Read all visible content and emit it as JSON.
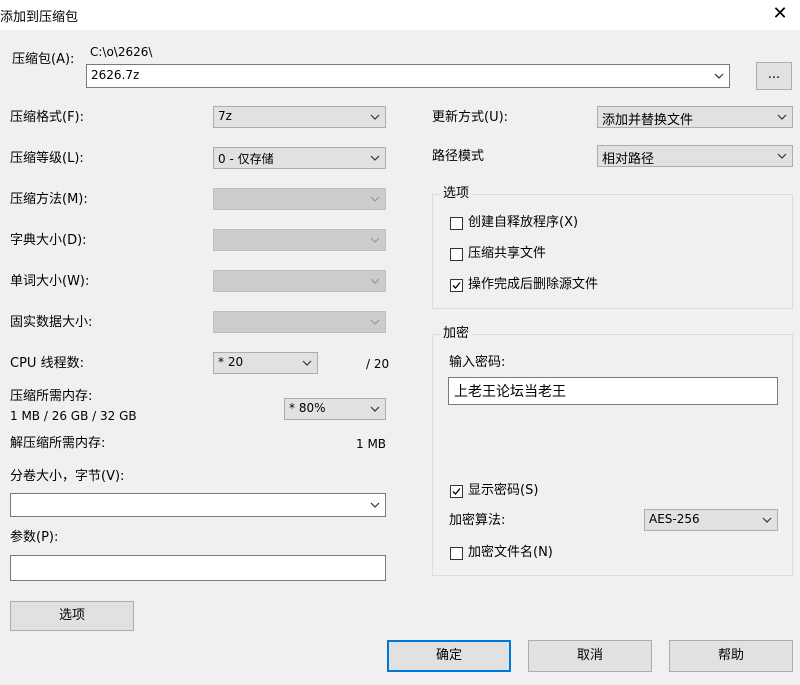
{
  "window": {
    "title": "添加到压缩包",
    "close_icon": "close-icon"
  },
  "archive": {
    "label": "压缩包(A):",
    "path": "C:\\o\\2626\\",
    "value": "2626.7z",
    "browse_label": "..."
  },
  "left": {
    "format": {
      "label": "压缩格式(F):",
      "value": "7z"
    },
    "level": {
      "label": "压缩等级(L):",
      "value": "0 - 仅存储"
    },
    "method": {
      "label": "压缩方法(M):",
      "value": ""
    },
    "dict": {
      "label": "字典大小(D):",
      "value": ""
    },
    "word": {
      "label": "单词大小(W):",
      "value": ""
    },
    "solid": {
      "label": "固实数据大小:",
      "value": ""
    },
    "cpu": {
      "label": "CPU 线程数:",
      "value": "* 20",
      "max": "/ 20"
    },
    "mem_compress": {
      "label": "压缩所需内存:",
      "detail": "1 MB / 26 GB / 32 GB",
      "value": "* 80%"
    },
    "mem_decompress": {
      "label": "解压缩所需内存:",
      "value": "1 MB"
    },
    "split": {
      "label": "分卷大小，字节(V):",
      "value": ""
    },
    "params": {
      "label": "参数(P):",
      "value": ""
    },
    "options_button": "选项"
  },
  "right": {
    "update": {
      "label": "更新方式(U):",
      "value": "添加并替换文件"
    },
    "path_mode": {
      "label": "路径模式",
      "value": "相对路径"
    },
    "options_group": {
      "title": "选项",
      "items": [
        {
          "label": "创建自释放程序(X)",
          "checked": false
        },
        {
          "label": "压缩共享文件",
          "checked": false
        },
        {
          "label": "操作完成后删除源文件",
          "checked": true
        }
      ]
    },
    "encryption": {
      "title": "加密",
      "password_label": "输入密码:",
      "password_value": "上老王论坛当老王",
      "show_password": {
        "label": "显示密码(S)",
        "checked": true
      },
      "method_label": "加密算法:",
      "method_value": "AES-256",
      "encrypt_names": {
        "label": "加密文件名(N)",
        "checked": false
      }
    }
  },
  "buttons": {
    "ok": "确定",
    "cancel": "取消",
    "help": "帮助"
  },
  "colors": {
    "default_button_border": "#0078d7",
    "dialog_bg": "#f0f0f0"
  }
}
